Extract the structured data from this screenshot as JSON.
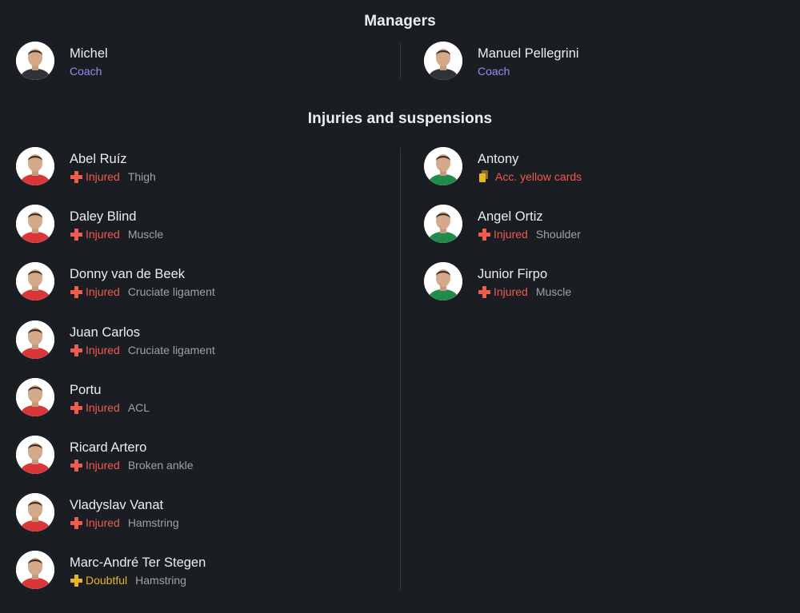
{
  "managers": {
    "title": "Managers",
    "home": {
      "name": "Michel",
      "role": "Coach"
    },
    "away": {
      "name": "Manuel Pellegrini",
      "role": "Coach"
    }
  },
  "injuries": {
    "title": "Injuries and suspensions",
    "home": [
      {
        "name": "Abel Ruíz",
        "status": "Injured",
        "reason": "Thigh"
      },
      {
        "name": "Daley Blind",
        "status": "Injured",
        "reason": "Muscle"
      },
      {
        "name": "Donny van de Beek",
        "status": "Injured",
        "reason": "Cruciate ligament"
      },
      {
        "name": "Juan Carlos",
        "status": "Injured",
        "reason": "Cruciate ligament"
      },
      {
        "name": "Portu",
        "status": "Injured",
        "reason": "ACL"
      },
      {
        "name": "Ricard Artero",
        "status": "Injured",
        "reason": "Broken ankle"
      },
      {
        "name": "Vladyslav Vanat",
        "status": "Injured",
        "reason": "Hamstring"
      },
      {
        "name": "Marc-André Ter Stegen",
        "status": "Doubtful",
        "reason": "Hamstring"
      }
    ],
    "away": [
      {
        "name": "Antony",
        "status": "Acc. yellow cards",
        "reason": ""
      },
      {
        "name": "Angel Ortiz",
        "status": "Injured",
        "reason": "Shoulder"
      },
      {
        "name": "Junior Firpo",
        "status": "Injured",
        "reason": "Muscle"
      }
    ]
  },
  "colors": {
    "background": "#1a1d21",
    "coach": "#8f8ff5",
    "injured": "#ef5b4f",
    "doubtful": "#e8b52a",
    "reason": "#9ea3a9",
    "home_kit": "#d9363a",
    "away_kit": "#1f8a4c"
  },
  "icons": {
    "injured": "plus-icon",
    "doubtful": "plus-icon",
    "suspended": "yellow-cards-icon",
    "player": "player-avatar"
  }
}
